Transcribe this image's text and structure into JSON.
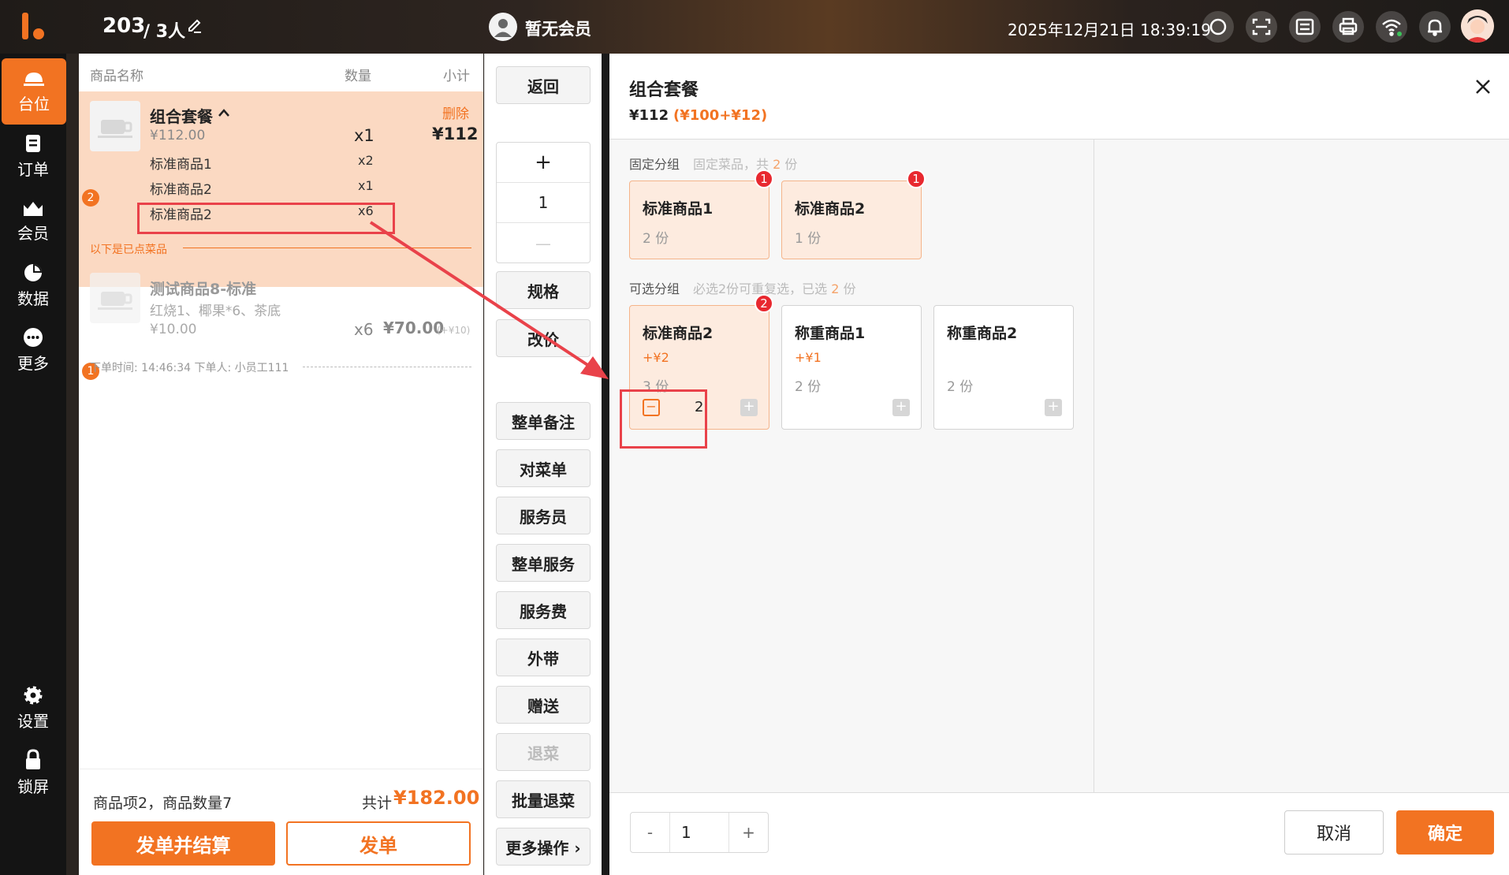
{
  "header": {
    "table_no": "203",
    "people": "/ 3人",
    "member_status": "暂无会员",
    "datetime": "2025年12月21日 18:39:19"
  },
  "nav": {
    "items": [
      {
        "label": "台位",
        "icon": "dining-table-icon",
        "active": true
      },
      {
        "label": "订单",
        "icon": "order-icon"
      },
      {
        "label": "会员",
        "icon": "member-icon"
      },
      {
        "label": "数据",
        "icon": "pie-chart-icon"
      },
      {
        "label": "更多",
        "icon": "more-icon"
      }
    ],
    "bottom": [
      {
        "label": "设置",
        "icon": "gear-icon"
      },
      {
        "label": "锁屏",
        "icon": "lock-icon"
      }
    ]
  },
  "order": {
    "columns": {
      "name": "商品名称",
      "qty": "数量",
      "subtotal": "小计"
    },
    "combo": {
      "badge": "2",
      "name": "组合套餐",
      "price": "¥112.00",
      "qty": "x1",
      "subtotal": "¥112",
      "delete": "删除",
      "subitems": [
        {
          "name": "标准商品1",
          "qty": "x2"
        },
        {
          "name": "标准商品2",
          "qty": "x1"
        },
        {
          "name": "标准商品2",
          "qty": "x6"
        }
      ]
    },
    "ordered_divider": "以下是已点菜品",
    "ordered_item": {
      "badge": "1",
      "name": "测试商品8-标准",
      "desc": "红烧1、椰果*6、茶底",
      "price": "¥10.00",
      "qty": "x6",
      "subtotal": "¥70.00",
      "extra": "(+¥10)"
    },
    "order_meta": "下单时间: 14:46:34    下单人: 小员工111",
    "summary": "商品项2，商品数量7",
    "total_label": "共计",
    "total": "¥182.00",
    "btn_send_settle": "发单并结算",
    "btn_send": "发单"
  },
  "actions": {
    "back": "返回",
    "qty_plus": "+",
    "qty_value": "1",
    "qty_minus": "—",
    "spec": "规格",
    "reprice": "改价",
    "buttons": [
      "整单备注",
      "对菜单",
      "服务员",
      "整单服务",
      "服务费",
      "外带",
      "赠送",
      "退菜",
      "批量退菜"
    ],
    "more": "更多操作 ›"
  },
  "dialog": {
    "title": "组合套餐",
    "price": "¥112",
    "price_detail": "(¥100+¥12)",
    "fixed_group": {
      "title": "固定分组",
      "hint_prefix": "固定菜品，共",
      "hint_count": "2",
      "hint_suffix": "份",
      "items": [
        {
          "name": "标准商品1",
          "qty": "2 份",
          "badge": "1"
        },
        {
          "name": "标准商品2",
          "qty": "1 份",
          "badge": "1"
        }
      ]
    },
    "optional_group": {
      "title": "可选分组",
      "hint_prefix": "必选2份可重复选，已选",
      "hint_count": "2",
      "hint_suffix": "份",
      "items": [
        {
          "name": "标准商品2",
          "extra": "+¥2",
          "qty": "3 份",
          "badge": "2",
          "selected_qty": "2",
          "minus": "−",
          "plus": "+"
        },
        {
          "name": "称重商品1",
          "extra": "+¥1",
          "qty": "2 份",
          "plus": "+"
        },
        {
          "name": "称重商品2",
          "extra": "",
          "qty": "2 份",
          "plus": "+"
        }
      ]
    },
    "stepper": {
      "minus": "-",
      "value": "1",
      "plus": "+"
    },
    "cancel": "取消",
    "confirm": "确定"
  },
  "colors": {
    "accent": "#f27322",
    "badge_red": "#e8282f",
    "annotation": "#e9424a"
  }
}
